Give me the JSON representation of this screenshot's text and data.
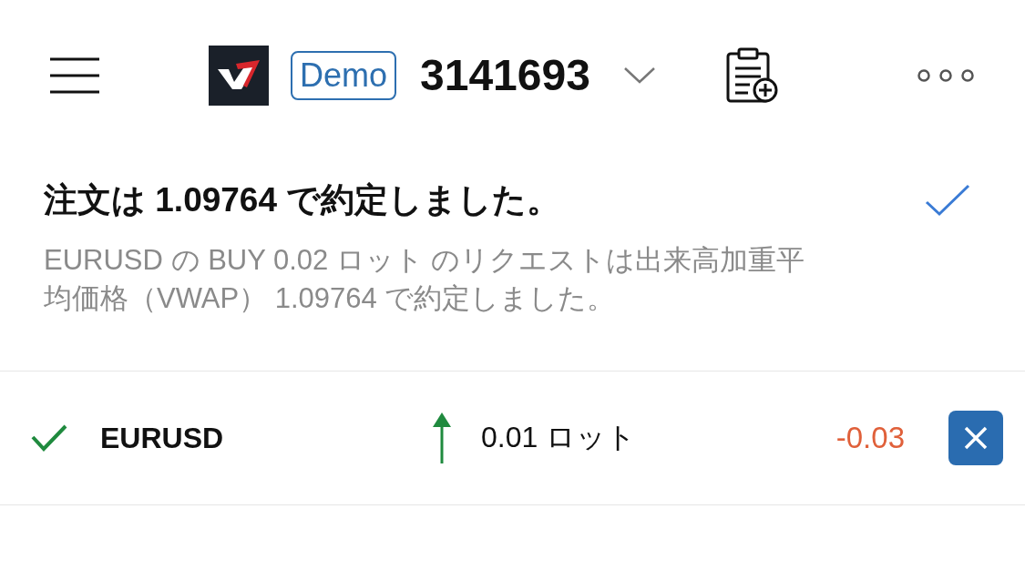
{
  "header": {
    "account_badge": "Demo",
    "account_number": "3141693"
  },
  "notification": {
    "title": "注文は 1.09764 で約定しました。",
    "message": "EURUSD の BUY 0.02 ロット のリクエストは出来高加重平均価格（VWAP） 1.09764 で約定しました。",
    "confirmed": true
  },
  "positions": [
    {
      "confirmed": true,
      "symbol": "EURUSD",
      "kind": "buy",
      "volume": "0.01 ロット",
      "profit": "-0.03"
    }
  ]
}
